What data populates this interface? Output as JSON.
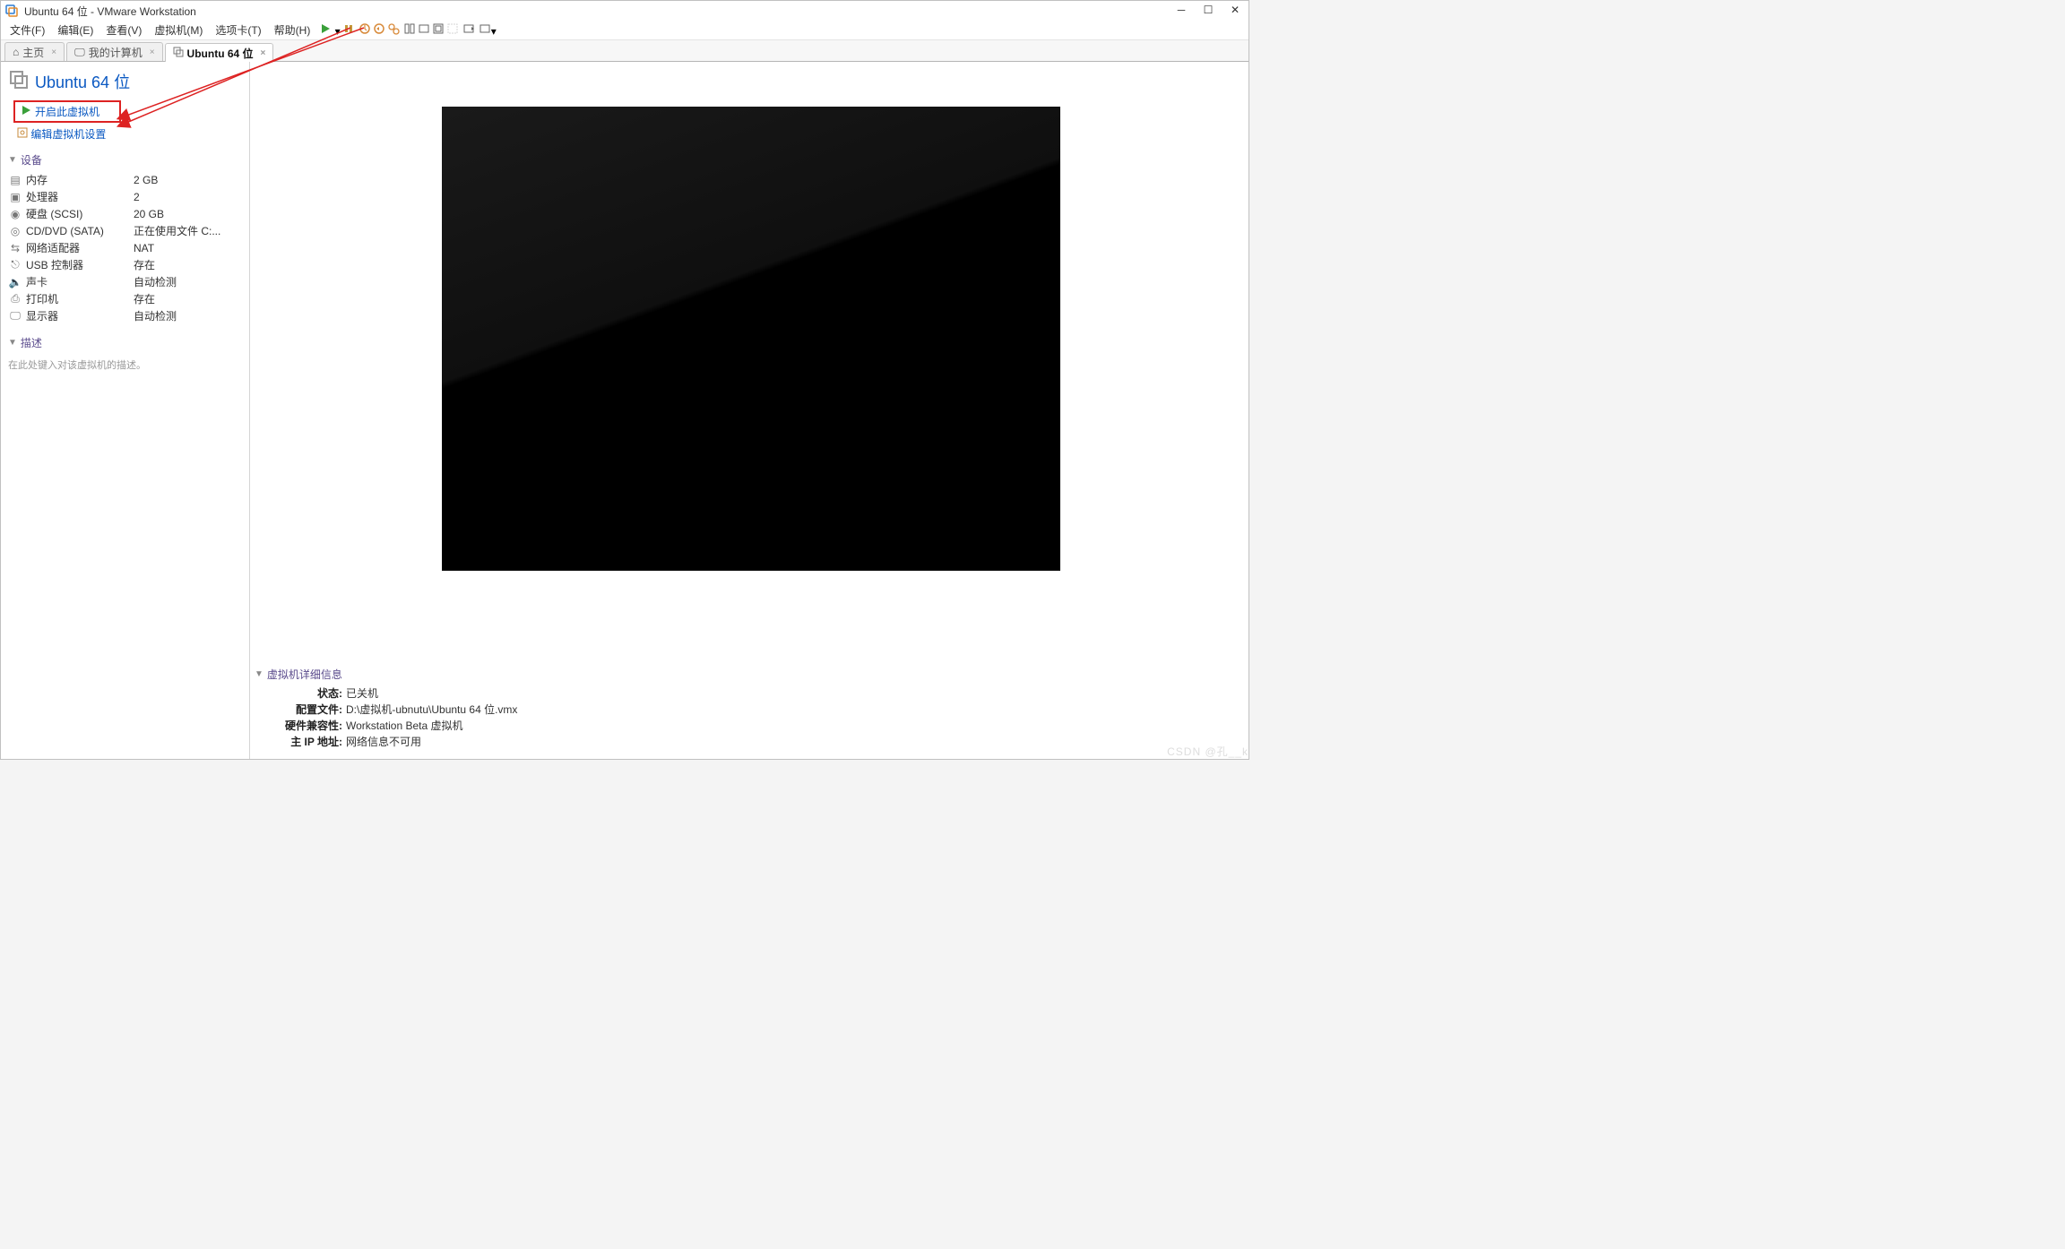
{
  "window": {
    "title": "Ubuntu 64 位 - VMware Workstation"
  },
  "menu": {
    "file": "文件(F)",
    "edit": "编辑(E)",
    "view": "查看(V)",
    "vm": "虚拟机(M)",
    "tabs": "选项卡(T)",
    "help": "帮助(H)"
  },
  "tabs": {
    "home": "主页",
    "mycomputer": "我的计算机",
    "current": "Ubuntu 64 位"
  },
  "vm": {
    "name": "Ubuntu 64 位",
    "start_action": "开启此虚拟机",
    "edit_action": "编辑虚拟机设置"
  },
  "devices": {
    "section_title": "设备",
    "memory_label": "内存",
    "memory_value": "2 GB",
    "cpu_label": "处理器",
    "cpu_value": "2",
    "disk_label": "硬盘 (SCSI)",
    "disk_value": "20 GB",
    "cd_label": "CD/DVD (SATA)",
    "cd_value": "正在使用文件 C:...",
    "net_label": "网络适配器",
    "net_value": "NAT",
    "usb_label": "USB 控制器",
    "usb_value": "存在",
    "sound_label": "声卡",
    "sound_value": "自动检测",
    "printer_label": "打印机",
    "printer_value": "存在",
    "display_label": "显示器",
    "display_value": "自动检测"
  },
  "description": {
    "section_title": "描述",
    "placeholder": "在此处键入对该虚拟机的描述。"
  },
  "details": {
    "section_title": "虚拟机详细信息",
    "state_label": "状态:",
    "state_value": "已关机",
    "config_label": "配置文件:",
    "config_value": "D:\\虚拟机-ubnutu\\Ubuntu 64 位.vmx",
    "hw_label": "硬件兼容性:",
    "hw_value": "Workstation Beta 虚拟机",
    "ip_label": "主 IP 地址:",
    "ip_value": "网络信息不可用"
  },
  "watermark": "CSDN @孔__k"
}
